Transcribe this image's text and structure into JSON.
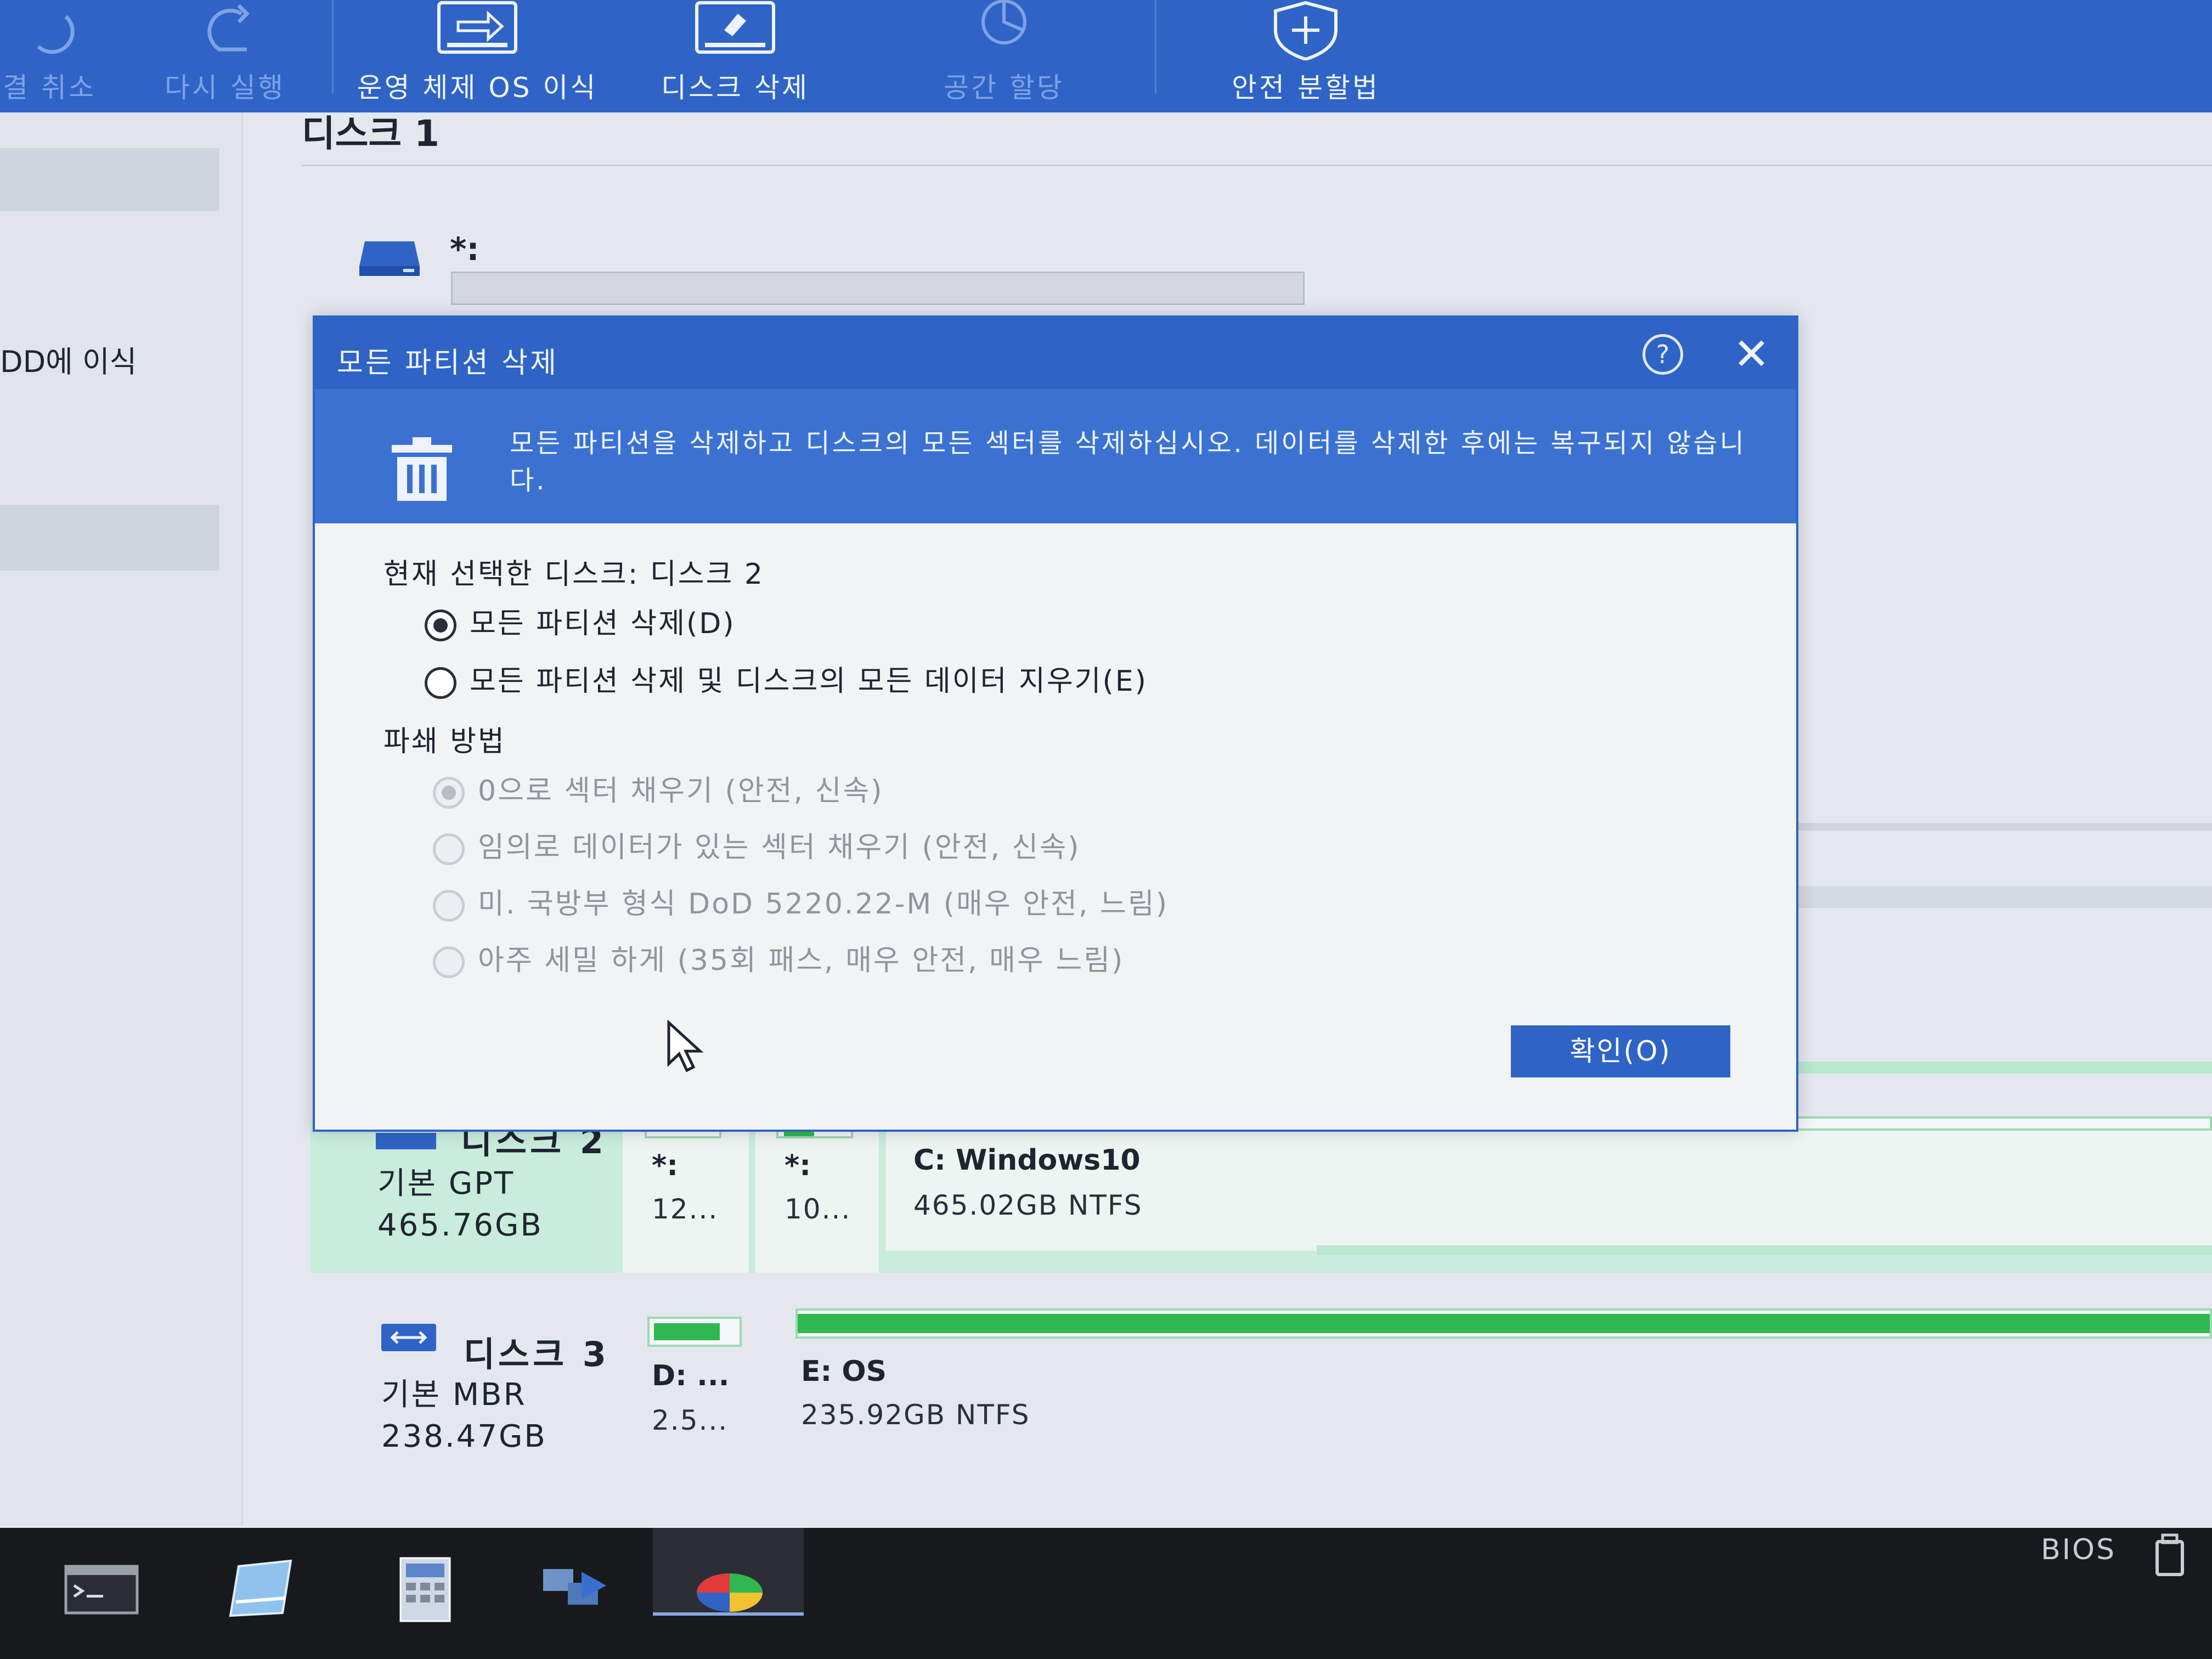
{
  "toolbar": {
    "items": [
      {
        "label": "결 취소",
        "icon": "undo-icon"
      },
      {
        "label": "다시 실행",
        "icon": "redo-icon"
      },
      {
        "label": "운영 체제 OS 이식",
        "icon": "migrate-os-icon"
      },
      {
        "label": "디스크 삭제",
        "icon": "wipe-disk-icon"
      },
      {
        "label": "공간 할당",
        "icon": "allocate-space-icon"
      },
      {
        "label": "안전 분할법",
        "icon": "safe-partition-icon"
      }
    ]
  },
  "left_panel": {
    "item_text": "DD에 이식"
  },
  "main": {
    "disk1": {
      "title": "디스크 1",
      "partition_label": "*:"
    },
    "disk2": {
      "name": "디스크 2",
      "type": "기본 GPT",
      "size": "465.76GB",
      "partitions": [
        {
          "label": "*:",
          "sub": "12..."
        },
        {
          "label": "*:",
          "sub": "10..."
        },
        {
          "label": "C: Windows10",
          "sub": "465.02GB NTFS"
        }
      ]
    },
    "disk3": {
      "name": "디스크 3",
      "type": "기본 MBR",
      "size": "238.47GB",
      "partitions": [
        {
          "label": "D: ...",
          "sub": "2.5..."
        },
        {
          "label": "E: OS",
          "sub": "235.92GB NTFS"
        }
      ]
    }
  },
  "dialog": {
    "title": "모든 파티션 삭제",
    "help_icon": "help-icon",
    "close_icon": "close-icon",
    "banner_icon": "trash-icon",
    "banner_text": "모든 파티션을 삭제하고 디스크의 모든 섹터를 삭제하십시오. 데이터를 삭제한 후에는 복구되지 않습니다.",
    "current_disk": "현재 선택한 디스크: 디스크 2",
    "options": [
      {
        "label": "모든 파티션 삭제(D)",
        "checked": true
      },
      {
        "label": "모든 파티션 삭제 및 디스크의 모든 데이터 지우기(E)",
        "checked": false
      }
    ],
    "destroy_title": "파쇄 방법",
    "destroy_methods": [
      {
        "label": "0으로 섹터 채우기 (안전, 신속)",
        "checked": true,
        "enabled": false
      },
      {
        "label": "임의로 데이터가 있는 섹터 채우기 (안전, 신속)",
        "checked": false,
        "enabled": false
      },
      {
        "label": "미. 국방부 형식 DoD 5220.22-M (매우 안전, 느림)",
        "checked": false,
        "enabled": false
      },
      {
        "label": "아주 세밀 하게 (35회 패스, 매우 안전, 매우 느림)",
        "checked": false,
        "enabled": false
      }
    ],
    "ok_label": "확인(O)"
  },
  "taskbar": {
    "bios_label": "BIOS",
    "icons": [
      "terminal-icon",
      "notepad-icon",
      "calculator-icon",
      "network-icon",
      "partition-tool-icon"
    ]
  },
  "colors": {
    "accent": "#2f64c6",
    "banner": "#3b72d2",
    "partition_used": "#2fb84f",
    "selected_disk_row": "#c9ecdd"
  }
}
